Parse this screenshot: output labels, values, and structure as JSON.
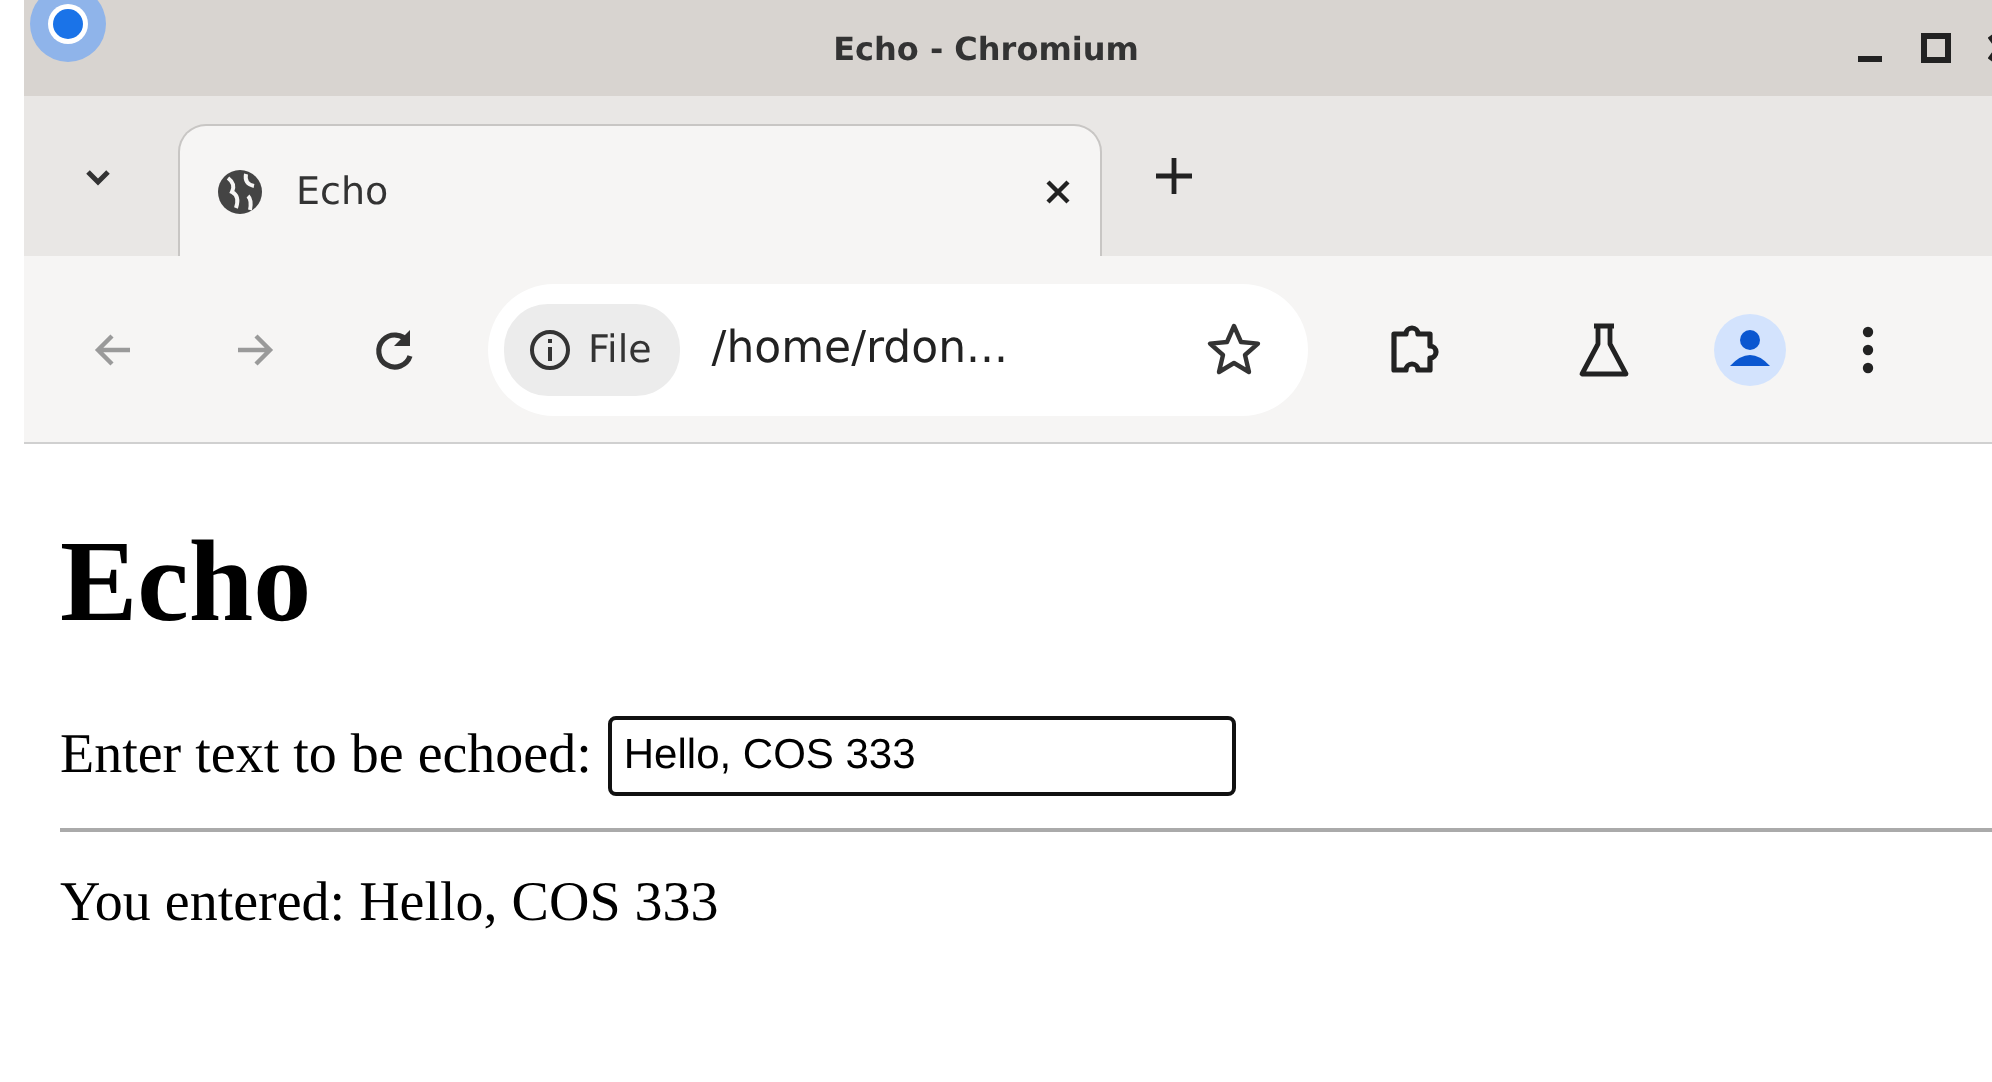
{
  "window": {
    "title": "Echo - Chromium"
  },
  "tabs": [
    {
      "label": "Echo",
      "selected": true
    }
  ],
  "navigation": {
    "back_disabled": true,
    "forward_disabled": true
  },
  "address_bar": {
    "chip": "File",
    "url": "/home/rdon..."
  },
  "page": {
    "heading": "Echo",
    "prompt": "Enter text to be echoed:",
    "field": {
      "value": "Hello, COS 333"
    },
    "result": "You entered: Hello, COS 333"
  }
}
